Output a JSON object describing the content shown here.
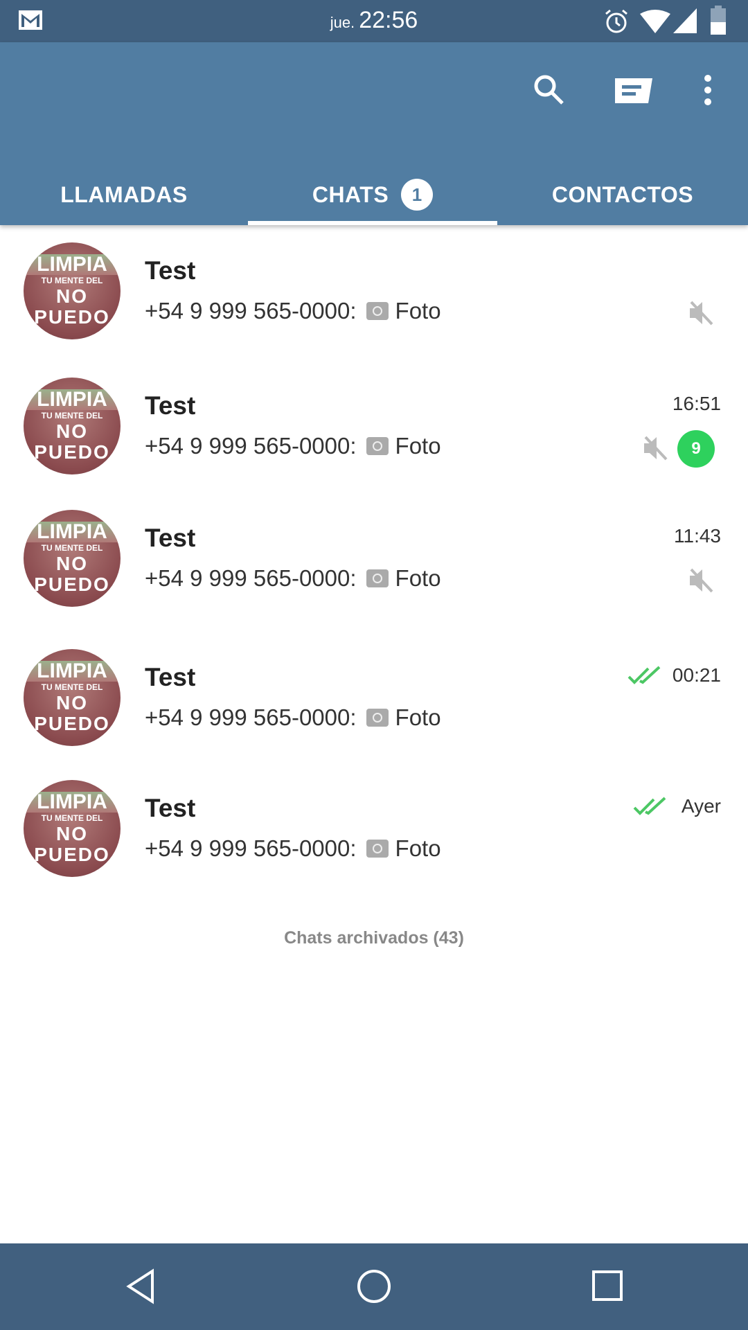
{
  "status_bar": {
    "day": "jue.",
    "time": "22:56",
    "icons": [
      "gmail-icon",
      "alarm-icon",
      "wifi-icon",
      "signal-icon",
      "battery-icon"
    ]
  },
  "app_bar": {
    "actions": [
      "search-icon",
      "new-chat-icon",
      "more-vert-icon"
    ]
  },
  "tabs": [
    {
      "label": "LLAMADAS"
    },
    {
      "label": "CHATS",
      "badge": "1",
      "active": true
    },
    {
      "label": "CONTACTOS"
    }
  ],
  "avatar_text": {
    "l1": "LIMPIA",
    "l2": "TU MENTE DEL",
    "l3": "NO PUEDO"
  },
  "chats": [
    {
      "name": "Test",
      "sender": "+54 9 999 565-0000:",
      "message": "Foto",
      "time": "",
      "muted": true,
      "unread": null,
      "read_ticks": false
    },
    {
      "name": "Test",
      "sender": "+54 9 999 565-0000:",
      "message": "Foto",
      "time": "16:51",
      "muted": true,
      "unread": "9",
      "read_ticks": false
    },
    {
      "name": "Test",
      "sender": "+54 9 999 565-0000:",
      "message": "Foto",
      "time": "11:43",
      "muted": true,
      "unread": null,
      "read_ticks": false
    },
    {
      "name": "Test",
      "sender": "+54 9 999 565-0000:",
      "message": "Foto",
      "time": "00:21",
      "muted": false,
      "unread": null,
      "read_ticks": true
    },
    {
      "name": "Test",
      "sender": "+54 9 999 565-0000:",
      "message": "Foto",
      "time": "Ayer",
      "muted": false,
      "unread": null,
      "read_ticks": true
    }
  ],
  "archived_label": "Chats archivados (43)",
  "colors": {
    "status_bar": "#40607f",
    "app_bar": "#517da2",
    "unread_badge": "#2ed15d",
    "ticks": "#4cc764"
  },
  "nav_bar": {
    "buttons": [
      "back-icon",
      "home-icon",
      "recents-icon"
    ]
  }
}
